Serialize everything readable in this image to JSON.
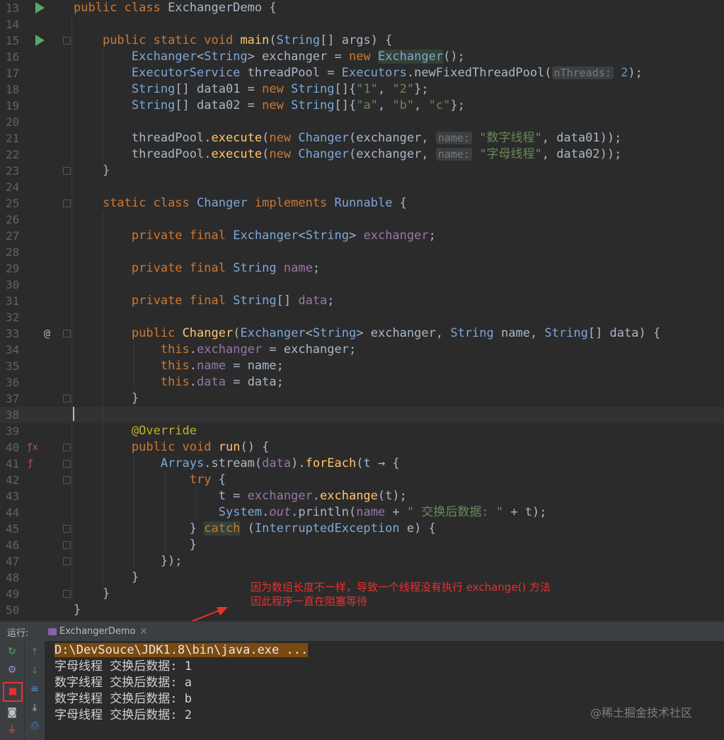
{
  "editor": {
    "lines": [
      {
        "n": "13",
        "html": "<span class='kw'>public class</span> ExchangerDemo {"
      },
      {
        "n": "14",
        "html": ""
      },
      {
        "n": "15",
        "html": "    <span class='kw'>public static void</span> <span class='fn'>main</span>(<span class='cl'>String</span>[] args) {"
      },
      {
        "n": "16",
        "html": "        <span class='cl'>Exchanger</span>&lt;<span class='cl'>String</span>&gt; exchanger = <span class='kw'>new</span> <span class='cl hl'>Exchanger</span>();"
      },
      {
        "n": "17",
        "html": "        <span class='cl'>ExecutorService</span> threadPool = <span class='cl'>Executors</span>.newFixedThreadPool(<span class='hint'>nThreads:</span> <span class='num'>2</span>);"
      },
      {
        "n": "18",
        "html": "        <span class='cl'>String</span>[] data01 = <span class='kw'>new</span> <span class='cl'>String</span>[]{<span class='st'>\"1\"</span>, <span class='st'>\"2\"</span>};"
      },
      {
        "n": "19",
        "html": "        <span class='cl'>String</span>[] data02 = <span class='kw'>new</span> <span class='cl'>String</span>[]{<span class='st'>\"a\"</span>, <span class='st'>\"b\"</span>, <span class='st'>\"c\"</span>};"
      },
      {
        "n": "20",
        "html": ""
      },
      {
        "n": "21",
        "html": "        threadPool.<span class='fn'>execute</span>(<span class='kw'>new</span> <span class='cl'>Changer</span>(exchanger, <span class='hint'>name:</span> <span class='st'>\"数字线程\"</span>, data01));"
      },
      {
        "n": "22",
        "html": "        threadPool.<span class='fn'>execute</span>(<span class='kw'>new</span> <span class='cl'>Changer</span>(exchanger, <span class='hint'>name:</span> <span class='st'>\"字母线程\"</span>, data02));"
      },
      {
        "n": "23",
        "html": "    }"
      },
      {
        "n": "24",
        "html": ""
      },
      {
        "n": "25",
        "html": "    <span class='kw'>static class</span> <span class='cl'>Changer</span> <span class='kw'>implements</span> <span class='cl'>Runnable</span> {"
      },
      {
        "n": "26",
        "html": ""
      },
      {
        "n": "27",
        "html": "        <span class='kw'>private final</span> <span class='cl'>Exchanger</span>&lt;<span class='cl'>String</span>&gt; <span class='fld'>exchanger</span>;"
      },
      {
        "n": "28",
        "html": ""
      },
      {
        "n": "29",
        "html": "        <span class='kw'>private final</span> <span class='cl'>String</span> <span class='fld'>name</span>;"
      },
      {
        "n": "30",
        "html": ""
      },
      {
        "n": "31",
        "html": "        <span class='kw'>private final</span> <span class='cl'>String</span>[] <span class='fld'>data</span>;"
      },
      {
        "n": "32",
        "html": ""
      },
      {
        "n": "33",
        "html": "        <span class='kw'>public</span> <span class='fn'>Changer</span>(<span class='cl'>Exchanger</span>&lt;<span class='cl'>String</span>&gt; exchanger, <span class='cl'>String</span> name, <span class='cl'>String</span>[] data) {"
      },
      {
        "n": "34",
        "html": "            <span class='kw'>this</span>.<span class='fld'>exchanger</span> = exchanger;"
      },
      {
        "n": "35",
        "html": "            <span class='kw'>this</span>.<span class='fld'>name</span> = name;"
      },
      {
        "n": "36",
        "html": "            <span class='kw'>this</span>.<span class='fld'>data</span> = data;"
      },
      {
        "n": "37",
        "html": "        }"
      },
      {
        "n": "38",
        "html": ""
      },
      {
        "n": "39",
        "html": "        <span class='ann'>@Override</span>"
      },
      {
        "n": "40",
        "html": "        <span class='kw'>public void</span> <span class='fn'>run</span>() {"
      },
      {
        "n": "41",
        "html": "            <span class='cl'>Arrays</span>.stream(<span class='fld'>data</span>).<span class='fn'>forEach</span>(t → {"
      },
      {
        "n": "42",
        "html": "                <span class='kw'>try</span> {"
      },
      {
        "n": "43",
        "html": "                    t = <span class='fld'>exchanger</span>.<span class='fn'>exchange</span>(t);"
      },
      {
        "n": "44",
        "html": "                    <span class='cl'>System</span>.<span class='fld'><i>out</i></span>.println(<span class='fld'>name</span> + <span class='st'>\" 交换后数据: \"</span> + t);"
      },
      {
        "n": "45",
        "html": "                } <span class='kw hl'>catch</span> (<span class='cl'>InterruptedException</span> e) {"
      },
      {
        "n": "46",
        "html": "                }"
      },
      {
        "n": "47",
        "html": "            });"
      },
      {
        "n": "48",
        "html": "        }"
      },
      {
        "n": "49",
        "html": "    }"
      },
      {
        "n": "50",
        "html": "}"
      }
    ]
  },
  "annotation": {
    "line1": "因为数组长度不一样，导致一个线程没有执行 exchange() 方法",
    "line2": "因此程序一直在阻塞等待"
  },
  "run_panel": {
    "label": "运行:",
    "tab_title": "ExchangerDemo",
    "tab_close": "×"
  },
  "console": {
    "command": "D:\\DevSouce\\JDK1.8\\bin\\java.exe ...",
    "output": [
      "字母线程 交换后数据: 1",
      "数字线程 交换后数据: a",
      "数字线程 交换后数据: b",
      "字母线程 交换后数据: 2"
    ]
  },
  "watermark": "@稀土掘金技术社区",
  "colors": {
    "accent_red": "#e8302f",
    "run_green": "#59a869"
  }
}
